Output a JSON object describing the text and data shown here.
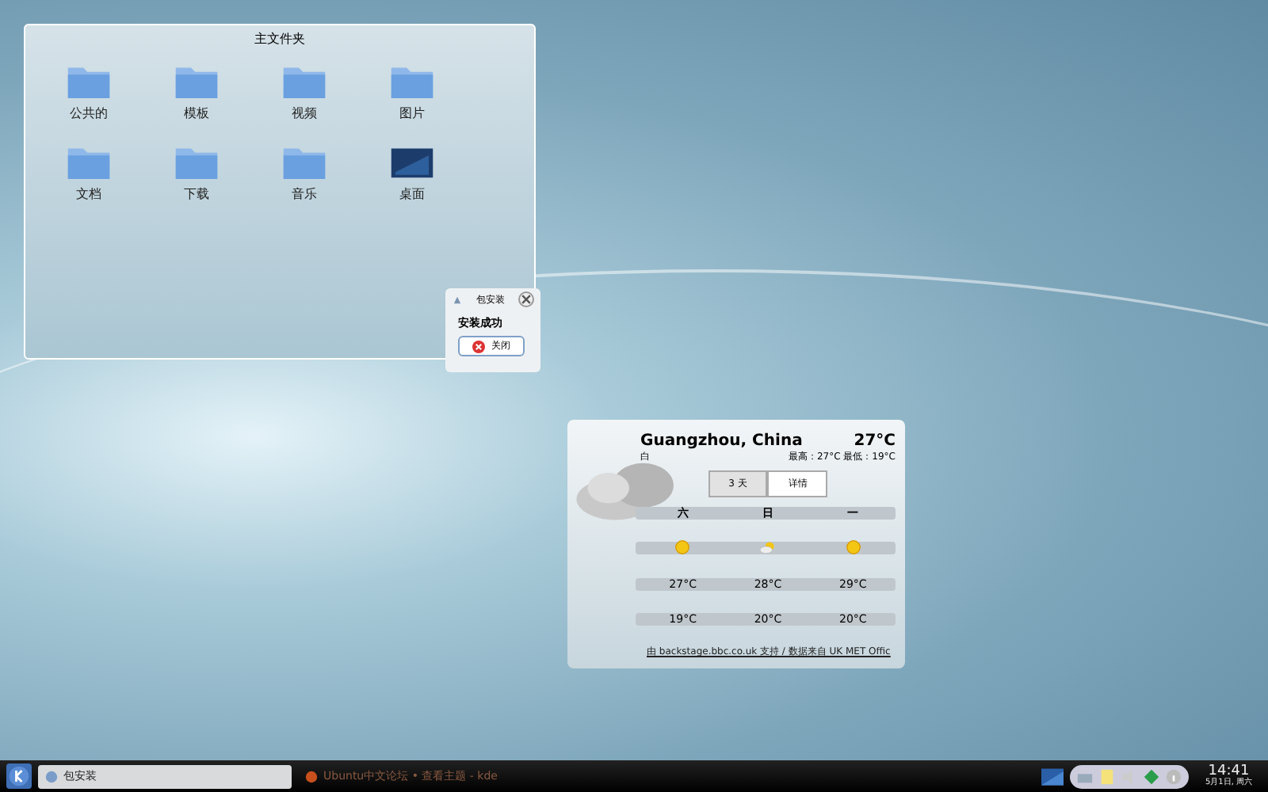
{
  "folder_view": {
    "title": "主文件夹",
    "items": [
      {
        "label": "公共的",
        "kind": "folder"
      },
      {
        "label": "模板",
        "kind": "folder"
      },
      {
        "label": "视频",
        "kind": "folder"
      },
      {
        "label": "图片",
        "kind": "folder"
      },
      {
        "label": "文档",
        "kind": "folder"
      },
      {
        "label": "下载",
        "kind": "folder"
      },
      {
        "label": "音乐",
        "kind": "folder"
      },
      {
        "label": "桌面",
        "kind": "desktop"
      }
    ]
  },
  "notification": {
    "title": "包安装",
    "message": "安装成功",
    "button": "关闭"
  },
  "weather": {
    "location": "Guangzhou, China",
    "condition": "白",
    "temperature": "27°C",
    "high_low": "最高：27°C 最低：19°C",
    "tabs": [
      {
        "label": "3 天",
        "selected": true
      },
      {
        "label": "详情",
        "selected": false
      }
    ],
    "days": [
      {
        "day": "六",
        "kind": "sun",
        "high": "27°C",
        "low": "19°C"
      },
      {
        "day": "日",
        "kind": "partly-cloudy",
        "high": "28°C",
        "low": "20°C"
      },
      {
        "day": "一",
        "kind": "sun",
        "high": "29°C",
        "low": "20°C"
      }
    ],
    "credit": "由 backstage.bbc.co.uk 支持 / 数据来自 UK MET Offic"
  },
  "taskbar": {
    "tasks": [
      {
        "label": "包安装",
        "selected": true
      },
      {
        "label": "Ubuntu中文论坛 • 查看主题 - kde",
        "selected": false
      }
    ],
    "time": "14:41",
    "date": "5月1日, 周六"
  }
}
